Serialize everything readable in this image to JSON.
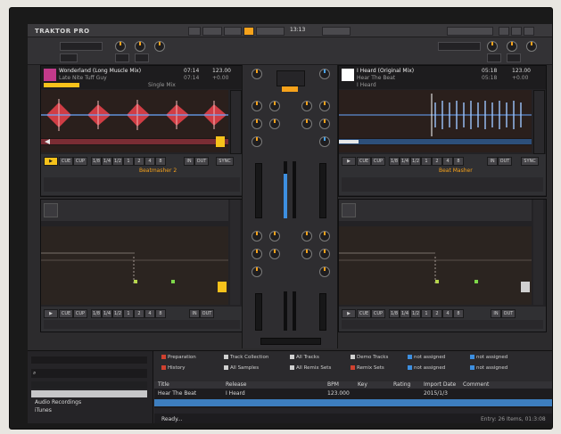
{
  "app": {
    "name": "TRAKTOR PRO",
    "clock": "13:13"
  },
  "decks": {
    "A": {
      "title": "Wonderland (Long Muscle Mix)",
      "time": "07:14",
      "bpm": "123.00",
      "artist": "Late Nite Tuff Guy",
      "remain": "07:14",
      "tempo_offset": "+0.00",
      "label": "Single Mix",
      "sync_label": "SYNC",
      "cue_label": "CUE",
      "cup_label": "CUP",
      "in_label": "IN",
      "out_label": "OUT",
      "loop_sizes": [
        "1/8",
        "1/4",
        "1/2",
        "1",
        "2",
        "4",
        "8"
      ],
      "fx_name": "Beatmasher 2"
    },
    "B": {
      "title": "I Heard (Original Mix)",
      "time": "05:18",
      "bpm": "123.00",
      "artist": "Hear The Beat",
      "remain": "05:18",
      "tempo_offset": "+0.00",
      "label": "I Heard",
      "sync_label": "SYNC",
      "cue_label": "CUE",
      "cup_label": "CUP",
      "in_label": "IN",
      "out_label": "OUT",
      "loop_sizes": [
        "1/8",
        "1/4",
        "1/2",
        "1",
        "2",
        "4",
        "8"
      ],
      "fx_name": "Beat Masher"
    },
    "C": {
      "cue_label": "CUE",
      "cup_label": "CUP",
      "in_label": "IN",
      "out_label": "OUT",
      "loop_sizes": [
        "1/8",
        "1/4",
        "1/2",
        "1",
        "2",
        "4",
        "8"
      ]
    },
    "D": {
      "cue_label": "CUE",
      "cup_label": "CUP",
      "in_label": "IN",
      "out_label": "OUT",
      "loop_sizes": [
        "1/8",
        "1/4",
        "1/2",
        "1",
        "2",
        "4",
        "8"
      ]
    }
  },
  "browser": {
    "tree": [
      "Audio Recordings",
      "iTunes"
    ],
    "favorites": [
      {
        "label": "Preparation",
        "color": "#d0412f"
      },
      {
        "label": "Track Collection",
        "color": "#d0d0d0"
      },
      {
        "label": "All Tracks",
        "color": "#d0d0d0"
      },
      {
        "label": "Demo Tracks",
        "color": "#d0d0d0"
      },
      {
        "label": "not assigned",
        "color": "#3d8fe0"
      },
      {
        "label": "not assigned",
        "color": "#3d8fe0"
      },
      {
        "label": "History",
        "color": "#d0412f"
      },
      {
        "label": "All Samples",
        "color": "#d0d0d0"
      },
      {
        "label": "All Remix Sets",
        "color": "#d0d0d0"
      },
      {
        "label": "Remix Sets",
        "color": "#d0412f"
      },
      {
        "label": "not assigned",
        "color": "#3d8fe0"
      },
      {
        "label": "not assigned",
        "color": "#3d8fe0"
      }
    ],
    "columns": [
      "Title",
      "Release",
      "BPM",
      "Key",
      "Rating",
      "Import Date",
      "Comment"
    ],
    "rows": [
      {
        "title": "Hear The Beat",
        "release": "I Heard",
        "bpm": "123.000",
        "key": "",
        "rating": "",
        "date": "2015/1/3",
        "comment": ""
      }
    ],
    "status": "Ready...",
    "footer": "Entry: 26 Items, 01:3:08"
  }
}
